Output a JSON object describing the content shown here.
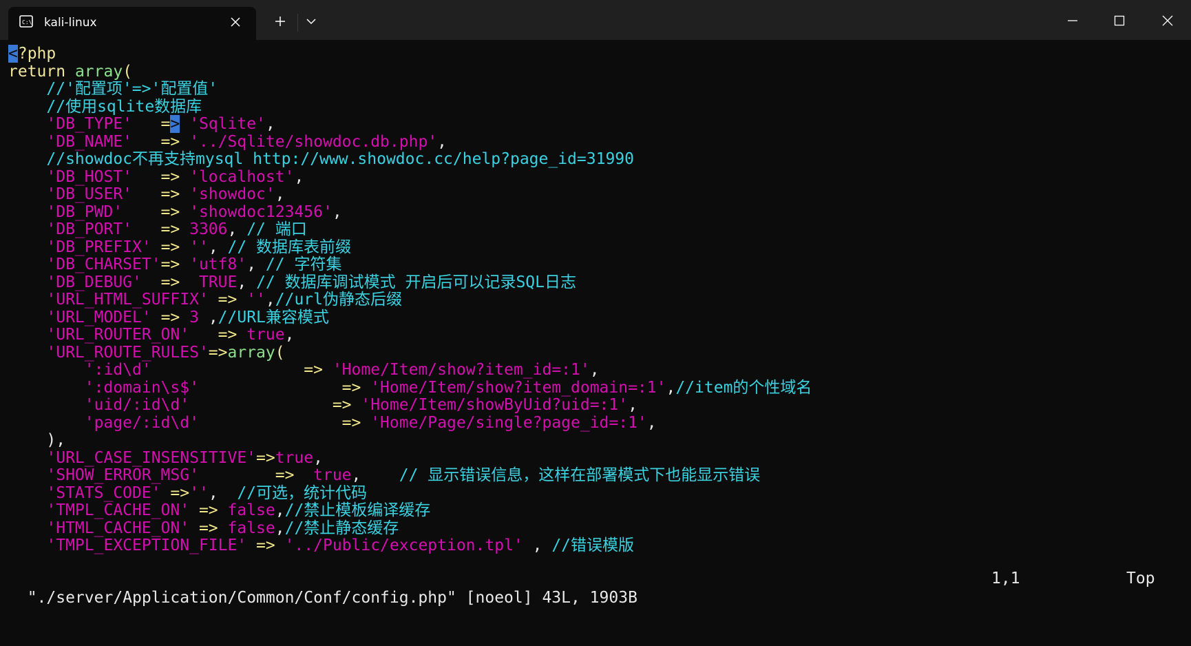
{
  "window": {
    "tab_title": "kali-linux",
    "controls": [
      "minimize-icon",
      "maximize-icon",
      "close-icon"
    ]
  },
  "editor": {
    "lines": [
      [
        {
          "t": "<",
          "c": "cur"
        },
        {
          "t": "?php",
          "c": "k"
        }
      ],
      [
        {
          "t": "return ",
          "c": "k"
        },
        {
          "t": "array",
          "c": "g"
        },
        {
          "t": "(",
          "c": "k"
        }
      ],
      [
        {
          "t": "    //'配置项'=>'配置值'",
          "c": "c"
        }
      ],
      [
        {
          "t": "    //使用sqlite数据库",
          "c": "c"
        }
      ],
      [
        {
          "t": "    ",
          "c": "w"
        },
        {
          "t": "'DB_TYPE'",
          "c": "s"
        },
        {
          "t": "   =",
          "c": "o"
        },
        {
          "t": ">",
          "c": "cur"
        },
        {
          "t": " ",
          "c": "w"
        },
        {
          "t": "'Sqlite'",
          "c": "s"
        },
        {
          "t": ",",
          "c": "w"
        }
      ],
      [
        {
          "t": "    ",
          "c": "w"
        },
        {
          "t": "'DB_NAME'",
          "c": "s"
        },
        {
          "t": "   => ",
          "c": "o"
        },
        {
          "t": "'../Sqlite/showdoc.db.php'",
          "c": "s"
        },
        {
          "t": ",",
          "c": "w"
        }
      ],
      [
        {
          "t": "    //showdoc不再支持mysql http://www.showdoc.cc/help?page_id=31990",
          "c": "c"
        }
      ],
      [
        {
          "t": "    ",
          "c": "w"
        },
        {
          "t": "'DB_HOST'",
          "c": "s"
        },
        {
          "t": "   => ",
          "c": "o"
        },
        {
          "t": "'localhost'",
          "c": "s"
        },
        {
          "t": ",",
          "c": "w"
        }
      ],
      [
        {
          "t": "    ",
          "c": "w"
        },
        {
          "t": "'DB_USER'",
          "c": "s"
        },
        {
          "t": "   => ",
          "c": "o"
        },
        {
          "t": "'showdoc'",
          "c": "s"
        },
        {
          "t": ",",
          "c": "w"
        }
      ],
      [
        {
          "t": "    ",
          "c": "w"
        },
        {
          "t": "'DB_PWD'",
          "c": "s"
        },
        {
          "t": "    => ",
          "c": "o"
        },
        {
          "t": "'showdoc123456'",
          "c": "s"
        },
        {
          "t": ",",
          "c": "w"
        }
      ],
      [
        {
          "t": "    ",
          "c": "w"
        },
        {
          "t": "'DB_PORT'",
          "c": "s"
        },
        {
          "t": "   => ",
          "c": "o"
        },
        {
          "t": "3306",
          "c": "s"
        },
        {
          "t": ", ",
          "c": "w"
        },
        {
          "t": "// 端口",
          "c": "c"
        }
      ],
      [
        {
          "t": "    ",
          "c": "w"
        },
        {
          "t": "'DB_PREFIX'",
          "c": "s"
        },
        {
          "t": " => ",
          "c": "o"
        },
        {
          "t": "''",
          "c": "s"
        },
        {
          "t": ", ",
          "c": "w"
        },
        {
          "t": "// 数据库表前缀",
          "c": "c"
        }
      ],
      [
        {
          "t": "    ",
          "c": "w"
        },
        {
          "t": "'DB_CHARSET'",
          "c": "s"
        },
        {
          "t": "=> ",
          "c": "o"
        },
        {
          "t": "'utf8'",
          "c": "s"
        },
        {
          "t": ", ",
          "c": "w"
        },
        {
          "t": "// 字符集",
          "c": "c"
        }
      ],
      [
        {
          "t": "    ",
          "c": "w"
        },
        {
          "t": "'DB_DEBUG'",
          "c": "s"
        },
        {
          "t": "  =>  ",
          "c": "o"
        },
        {
          "t": "TRUE",
          "c": "s"
        },
        {
          "t": ", ",
          "c": "w"
        },
        {
          "t": "// 数据库调试模式 开启后可以记录SQL日志",
          "c": "c"
        }
      ],
      [
        {
          "t": "    ",
          "c": "w"
        },
        {
          "t": "'URL_HTML_SUFFIX'",
          "c": "s"
        },
        {
          "t": " => ",
          "c": "o"
        },
        {
          "t": "''",
          "c": "s"
        },
        {
          "t": ",",
          "c": "w"
        },
        {
          "t": "//url伪静态后缀",
          "c": "c"
        }
      ],
      [
        {
          "t": "    ",
          "c": "w"
        },
        {
          "t": "'URL_MODEL'",
          "c": "s"
        },
        {
          "t": " => ",
          "c": "o"
        },
        {
          "t": "3",
          "c": "s"
        },
        {
          "t": " ,",
          "c": "w"
        },
        {
          "t": "//URL兼容模式",
          "c": "c"
        }
      ],
      [
        {
          "t": "    ",
          "c": "w"
        },
        {
          "t": "'URL_ROUTER_ON'",
          "c": "s"
        },
        {
          "t": "   => ",
          "c": "o"
        },
        {
          "t": "true",
          "c": "s"
        },
        {
          "t": ",",
          "c": "w"
        }
      ],
      [
        {
          "t": "    ",
          "c": "w"
        },
        {
          "t": "'URL_ROUTE_RULES'",
          "c": "s"
        },
        {
          "t": "=>",
          "c": "o"
        },
        {
          "t": "array",
          "c": "g"
        },
        {
          "t": "(",
          "c": "k"
        }
      ],
      [
        {
          "t": "        ",
          "c": "w"
        },
        {
          "t": "':id\\d'",
          "c": "s"
        },
        {
          "t": "                => ",
          "c": "o"
        },
        {
          "t": "'Home/Item/show?item_id=:1'",
          "c": "s"
        },
        {
          "t": ",",
          "c": "w"
        }
      ],
      [
        {
          "t": "        ",
          "c": "w"
        },
        {
          "t": "':domain\\s$'",
          "c": "s"
        },
        {
          "t": "               => ",
          "c": "o"
        },
        {
          "t": "'Home/Item/show?item_domain=:1'",
          "c": "s"
        },
        {
          "t": ",",
          "c": "w"
        },
        {
          "t": "//item的个性域名",
          "c": "c"
        }
      ],
      [
        {
          "t": "        ",
          "c": "w"
        },
        {
          "t": "'uid/:id\\d'",
          "c": "s"
        },
        {
          "t": "               => ",
          "c": "o"
        },
        {
          "t": "'Home/Item/showByUid?uid=:1'",
          "c": "s"
        },
        {
          "t": ",",
          "c": "w"
        }
      ],
      [
        {
          "t": "        ",
          "c": "w"
        },
        {
          "t": "'page/:id\\d'",
          "c": "s"
        },
        {
          "t": "               => ",
          "c": "o"
        },
        {
          "t": "'Home/Page/single?page_id=:1'",
          "c": "s"
        },
        {
          "t": ",",
          "c": "w"
        }
      ],
      [
        {
          "t": "    ),",
          "c": "w"
        }
      ],
      [
        {
          "t": "    ",
          "c": "w"
        },
        {
          "t": "'URL_CASE_INSENSITIVE'",
          "c": "s"
        },
        {
          "t": "=>",
          "c": "o"
        },
        {
          "t": "true",
          "c": "s"
        },
        {
          "t": ",",
          "c": "w"
        }
      ],
      [
        {
          "t": "    ",
          "c": "w"
        },
        {
          "t": "'SHOW_ERROR_MSG'",
          "c": "s"
        },
        {
          "t": "        =>  ",
          "c": "o"
        },
        {
          "t": "true",
          "c": "s"
        },
        {
          "t": ",    ",
          "c": "w"
        },
        {
          "t": "// 显示错误信息，这样在部署模式下也能显示错误",
          "c": "c"
        }
      ],
      [
        {
          "t": "    ",
          "c": "w"
        },
        {
          "t": "'STATS_CODE'",
          "c": "s"
        },
        {
          "t": " =>",
          "c": "o"
        },
        {
          "t": "''",
          "c": "s"
        },
        {
          "t": ",  ",
          "c": "w"
        },
        {
          "t": "//可选，统计代码",
          "c": "c"
        }
      ],
      [
        {
          "t": "    ",
          "c": "w"
        },
        {
          "t": "'TMPL_CACHE_ON'",
          "c": "s"
        },
        {
          "t": " => ",
          "c": "o"
        },
        {
          "t": "false",
          "c": "s"
        },
        {
          "t": ",",
          "c": "w"
        },
        {
          "t": "//禁止模板编译缓存",
          "c": "c"
        }
      ],
      [
        {
          "t": "    ",
          "c": "w"
        },
        {
          "t": "'HTML_CACHE_ON'",
          "c": "s"
        },
        {
          "t": " => ",
          "c": "o"
        },
        {
          "t": "false",
          "c": "s"
        },
        {
          "t": ",",
          "c": "w"
        },
        {
          "t": "//禁止静态缓存",
          "c": "c"
        }
      ],
      [
        {
          "t": "    ",
          "c": "w"
        },
        {
          "t": "'TMPL_EXCEPTION_FILE'",
          "c": "s"
        },
        {
          "t": " => ",
          "c": "o"
        },
        {
          "t": "'../Public/exception.tpl'",
          "c": "s"
        },
        {
          "t": " , ",
          "c": "w"
        },
        {
          "t": "//错误模版",
          "c": "c"
        }
      ]
    ]
  },
  "status": {
    "file": "\"./server/Application/Common/Conf/config.php\" [noeol] 43L, 1903B",
    "position": "1,1",
    "scroll": "Top"
  }
}
